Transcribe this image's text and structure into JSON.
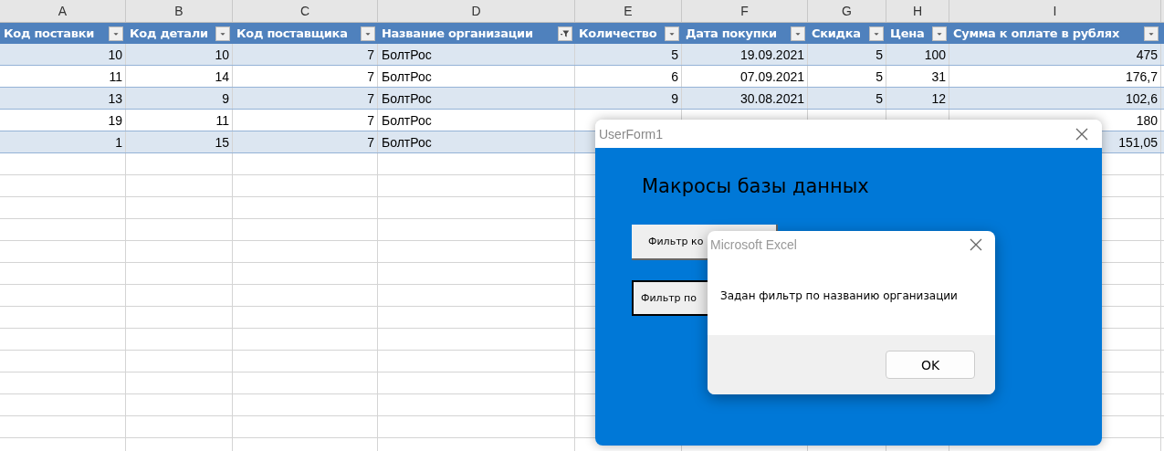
{
  "columns": [
    {
      "letter": "A",
      "header": "Код поставки",
      "kind": "number",
      "filtered": false
    },
    {
      "letter": "B",
      "header": "Код детали",
      "kind": "number",
      "filtered": false
    },
    {
      "letter": "C",
      "header": "Код поставщика",
      "kind": "number",
      "filtered": false
    },
    {
      "letter": "D",
      "header": "Название организации",
      "kind": "text",
      "filtered": true
    },
    {
      "letter": "E",
      "header": "Количество",
      "kind": "number",
      "filtered": false
    },
    {
      "letter": "F",
      "header": "Дата покупки",
      "kind": "number",
      "filtered": false
    },
    {
      "letter": "G",
      "header": "Скидка",
      "kind": "number",
      "filtered": false
    },
    {
      "letter": "H",
      "header": "Цена",
      "kind": "number",
      "filtered": false
    },
    {
      "letter": "I",
      "header": "Сумма к оплате в рублях",
      "kind": "number",
      "filtered": false
    }
  ],
  "rows": [
    {
      "A": "10",
      "B": "10",
      "C": "7",
      "D": "БолтРос",
      "E": "5",
      "F": "19.09.2021",
      "G": "5",
      "H": "100",
      "I": "475"
    },
    {
      "A": "11",
      "B": "14",
      "C": "7",
      "D": "БолтРос",
      "E": "6",
      "F": "07.09.2021",
      "G": "5",
      "H": "31",
      "I": "176,7"
    },
    {
      "A": "13",
      "B": "9",
      "C": "7",
      "D": "БолтРос",
      "E": "9",
      "F": "30.08.2021",
      "G": "5",
      "H": "12",
      "I": "102,6"
    },
    {
      "A": "19",
      "B": "11",
      "C": "7",
      "D": "БолтРос",
      "I": "180"
    },
    {
      "A": "1",
      "B": "15",
      "C": "7",
      "D": "БолтРос",
      "I": "151,05"
    }
  ],
  "userform": {
    "title": "UserForm1",
    "heading": "Макросы базы данных",
    "buttons": [
      "Фильтр ко",
      "Фильтр по"
    ]
  },
  "msgbox": {
    "title": "Microsoft Excel",
    "message": "Задан фильтр по названию организации",
    "button": "OK"
  }
}
